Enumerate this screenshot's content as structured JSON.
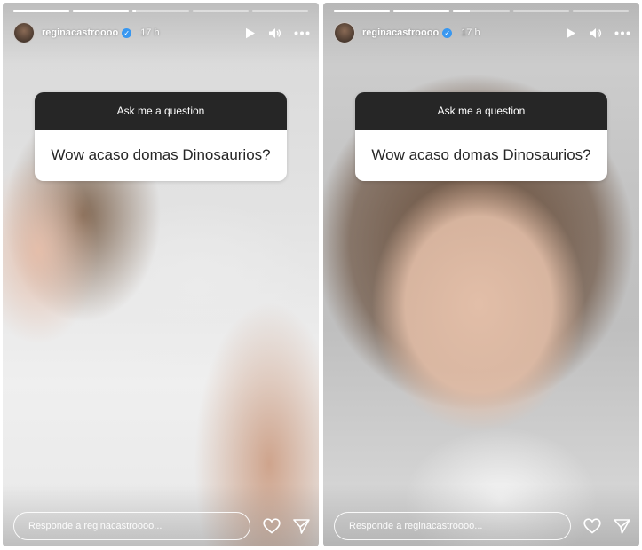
{
  "stories": [
    {
      "username": "reginacastroooo",
      "time": "17 h",
      "question_title": "Ask me a question",
      "question_text": "Wow acaso domas Dinosaurios?",
      "reply_placeholder": "Responde a reginacastroooo...",
      "progress": [
        1,
        1,
        0.05,
        0,
        0
      ]
    },
    {
      "username": "reginacastroooo",
      "time": "17 h",
      "question_title": "Ask me a question",
      "question_text": "Wow acaso domas Dinosaurios?",
      "reply_placeholder": "Responde a reginacastroooo...",
      "progress": [
        1,
        1,
        0.3,
        0,
        0
      ]
    }
  ],
  "icons": {
    "play": "play-icon",
    "sound": "speaker-icon",
    "more": "more-icon",
    "like": "heart-icon",
    "share": "send-icon",
    "verified": "verified-badge-icon"
  },
  "colors": {
    "question_header": "#262626",
    "question_body": "#ffffff",
    "verified": "#3897f0"
  }
}
